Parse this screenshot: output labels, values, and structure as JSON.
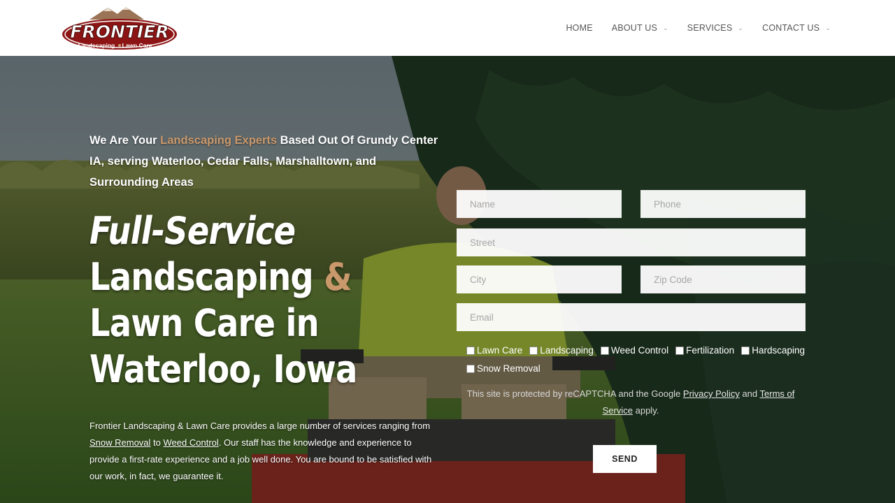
{
  "header": {
    "logo": {
      "name": "FRONTIER",
      "tagline_left": "Landscaping",
      "tagline_right": "Lawn Care"
    },
    "nav": [
      {
        "label": "HOME",
        "has_dropdown": false
      },
      {
        "label": "ABOUT US",
        "has_dropdown": true
      },
      {
        "label": "SERVICES",
        "has_dropdown": true
      },
      {
        "label": "CONTACT US",
        "has_dropdown": true
      }
    ]
  },
  "hero": {
    "intro_before": "We Are Your ",
    "intro_accent": "Landscaping Experts",
    "intro_after": " Based Out Of Grundy Center IA, serving Waterloo, Cedar Falls, Marshalltown, and Surrounding Areas",
    "headline_line1": "Full-Service",
    "headline_part2a": "Landscaping ",
    "headline_amp": "&",
    "headline_part2b": " Lawn Care in Waterloo, Iowa",
    "desc_1": "Frontier Landscaping & Lawn Care provides a large number of services ranging from ",
    "desc_link1": "Snow Removal",
    "desc_2": " to ",
    "desc_link2": "Weed Control",
    "desc_3": ". Our staff has the knowledge and experience to provide a first-rate experience and a job well done. You are bound to be satisfied with our work, in fact, we guarantee it."
  },
  "form": {
    "name_placeholder": "Name",
    "phone_placeholder": "Phone",
    "street_placeholder": "Street",
    "city_placeholder": "City",
    "zip_placeholder": "Zip Code",
    "email_placeholder": "Email",
    "services": [
      "Lawn Care",
      "Landscaping",
      "Weed Control",
      "Fertilization",
      "Hardscaping",
      "Snow Removal"
    ],
    "recaptcha_1": "This site is protected by reCAPTCHA and the Google ",
    "privacy_link": "Privacy Policy",
    "recaptcha_2": " and ",
    "terms_link": "Terms of Service",
    "recaptcha_3": " apply.",
    "send_label": "SEND"
  },
  "colors": {
    "accent": "#c9986b",
    "logo_red": "#8c1414"
  }
}
